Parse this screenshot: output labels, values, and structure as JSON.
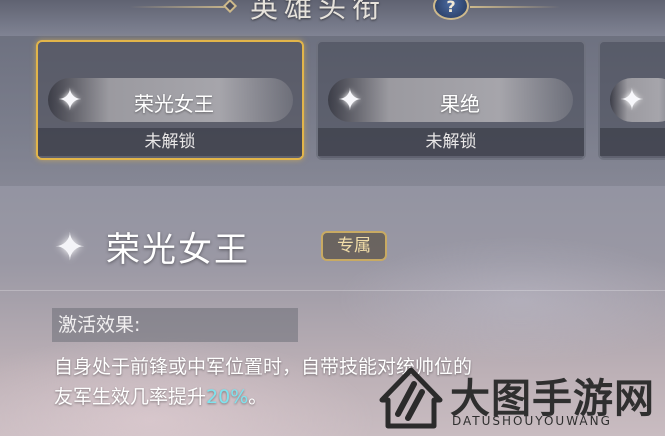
{
  "header": {
    "title": "英雄头衔",
    "help_icon": "?"
  },
  "cards": [
    {
      "icon": "star-icon",
      "name": "荣光女王",
      "status": "未解锁",
      "selected": true
    },
    {
      "icon": "star-icon",
      "name": "果绝",
      "status": "未解锁",
      "selected": false
    },
    {
      "icon": "star-icon",
      "name": "",
      "status": "",
      "selected": false
    }
  ],
  "detail": {
    "icon": "star-icon",
    "name": "荣光女王",
    "badge": "专属",
    "effect_label": "激活效果:",
    "desc_line1": "自身处于前锋或中军位置时，自带技能对统帅位的",
    "desc_line2_pre": "友军生效几率提升",
    "desc_line2_value": "20%",
    "desc_line2_post": "。"
  },
  "watermark": {
    "title": "大图手游网",
    "subtitle": "DATUSHOUYOUWANG"
  },
  "colors": {
    "selected_border": "#e2b54a",
    "highlight": "#7fe3ee",
    "badge_border": "#c8aa63"
  }
}
